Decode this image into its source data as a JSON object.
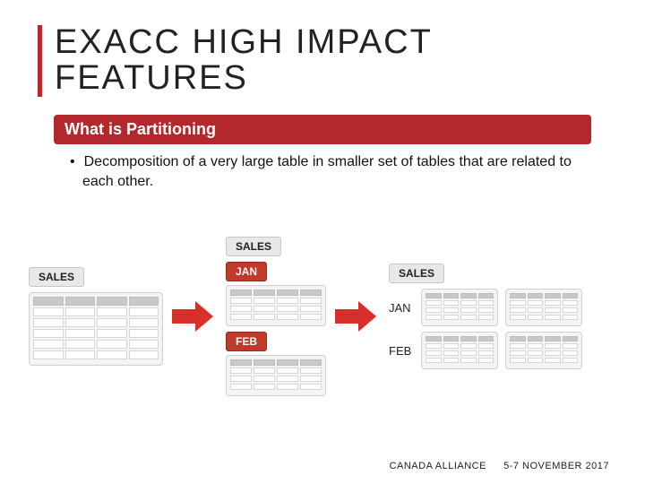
{
  "title_line1": "EXACC HIGH IMPACT",
  "title_line2": "FEATURES",
  "subtitle": "What is Partitioning",
  "bullet": "Decomposition of a very large table in smaller set of tables that are related to each other.",
  "labels": {
    "sales": "SALES",
    "jan": "JAN",
    "feb": "FEB"
  },
  "footer": {
    "org": "CANADA ALLIANCE",
    "date": "5-7 NOVEMBER 2017"
  }
}
